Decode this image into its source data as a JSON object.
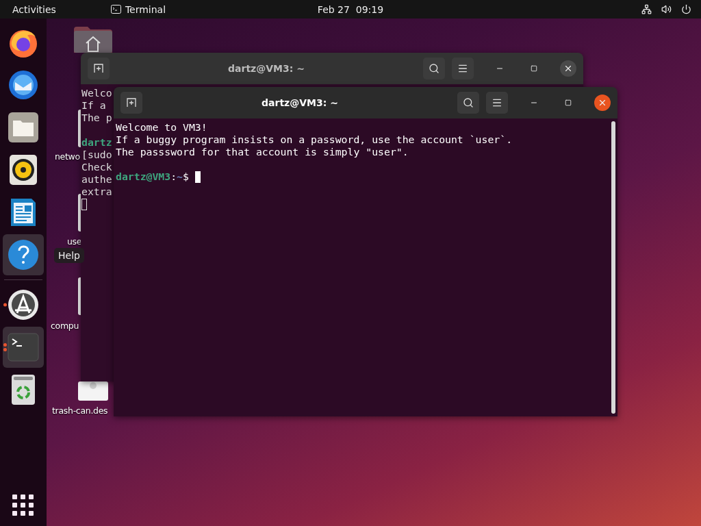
{
  "top_bar": {
    "activities": "Activities",
    "app_menu": {
      "label": "Terminal"
    },
    "clock": "Feb 27  09:19"
  },
  "dock": {
    "items": [
      {
        "kind": "browser",
        "running": false,
        "highlighted": false
      },
      {
        "kind": "mail",
        "running": false,
        "highlighted": false
      },
      {
        "kind": "files",
        "running": false,
        "highlighted": false
      },
      {
        "kind": "music",
        "running": false,
        "highlighted": false
      },
      {
        "kind": "writer",
        "running": false,
        "highlighted": false
      },
      {
        "kind": "help",
        "running": false,
        "highlighted": true
      },
      {
        "kind": "separator"
      },
      {
        "kind": "software",
        "running": true,
        "multiple_windows": false,
        "highlighted": false
      },
      {
        "kind": "terminal",
        "running": true,
        "multiple_windows": true,
        "highlighted": true
      },
      {
        "kind": "trash",
        "running": false,
        "highlighted": false
      }
    ],
    "tooltip": "Help"
  },
  "desktop_icons": [
    {
      "kind": "home"
    },
    {
      "kind": "file",
      "label": "netwo"
    },
    {
      "kind": "file",
      "label": "use"
    },
    {
      "kind": "file",
      "label": "compu"
    },
    {
      "kind": "trash",
      "label": "trash-can.des"
    }
  ],
  "windows": [
    {
      "title": "dartz@VM3: ~",
      "focused": false,
      "lines": [
        {
          "kind": "text",
          "text": "Welco"
        },
        {
          "kind": "text",
          "text": "If a"
        },
        {
          "kind": "text",
          "text": "The p"
        },
        {
          "kind": "blank"
        },
        {
          "kind": "prompt",
          "text": "dartz"
        },
        {
          "kind": "text",
          "text": "[sudo"
        },
        {
          "kind": "text",
          "text": "Check"
        },
        {
          "kind": "text",
          "text": "authe"
        },
        {
          "kind": "text",
          "text": "extra"
        },
        {
          "kind": "cursor"
        }
      ]
    },
    {
      "title": "dartz@VM3: ~",
      "focused": true,
      "lines": [
        {
          "kind": "text",
          "text": "Welcome to VM3!"
        },
        {
          "kind": "text",
          "text": "If a buggy program insists on a password, use the account `user`."
        },
        {
          "kind": "text",
          "text": "The passsword for that account is simply \"user\"."
        },
        {
          "kind": "blank"
        },
        {
          "kind": "prompt",
          "user": "dartz@VM3",
          "sep": ":",
          "path": "~",
          "symbol": "$"
        }
      ]
    }
  ]
}
